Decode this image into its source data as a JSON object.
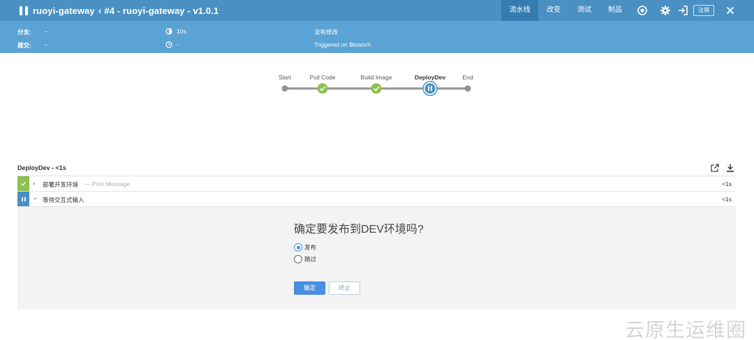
{
  "header": {
    "pipeline_name": "ruoyi-gateway",
    "run_title": "#4 - ruoyi-gateway - v1.0.1",
    "tabs": [
      {
        "label": "流水线",
        "active": true
      },
      {
        "label": "改变",
        "active": false
      },
      {
        "label": "测试",
        "active": false
      },
      {
        "label": "制品",
        "active": false
      }
    ],
    "icons": [
      "pause-icon",
      "chevron-left-icon",
      "pipeline-record-icon",
      "gear-icon",
      "exit-icon",
      "close-icon"
    ],
    "logout_label": "注销",
    "bg_color": "#4a90c2",
    "active_tab_color": "#357db0"
  },
  "info": {
    "branch_label": "分支:",
    "branch_value": "–",
    "commit_label": "提交:",
    "commit_value": "–",
    "duration_value": "10s",
    "time_value": "-",
    "changes_text": "没有修改",
    "trigger_text": "Triggered on $branch",
    "bg_color": "#5ba3d4"
  },
  "pipeline": {
    "stages": [
      {
        "name": "Start",
        "status": "start"
      },
      {
        "name": "Pull Code",
        "status": "success"
      },
      {
        "name": "Build Image",
        "status": "success"
      },
      {
        "name": "DeployDev",
        "status": "paused"
      },
      {
        "name": "End",
        "status": "end"
      }
    ],
    "success_color": "#8cc04f",
    "paused_color": "#4a90c2"
  },
  "log": {
    "title": "DeployDev - <1s",
    "steps": [
      {
        "name": "部署开发环境",
        "desc": "— Print Message",
        "duration": "<1s",
        "status": "success",
        "expanded": false
      },
      {
        "name": "等待交互式输入",
        "desc": "",
        "duration": "<1s",
        "status": "paused",
        "expanded": true
      }
    ]
  },
  "input": {
    "question": "确定要发布到DEV环境吗?",
    "options": [
      {
        "label": "发布",
        "checked": true
      },
      {
        "label": "跳过",
        "checked": false
      }
    ],
    "ok_label": "确定",
    "abort_label": "终止"
  },
  "watermark": "云原生运维圈"
}
